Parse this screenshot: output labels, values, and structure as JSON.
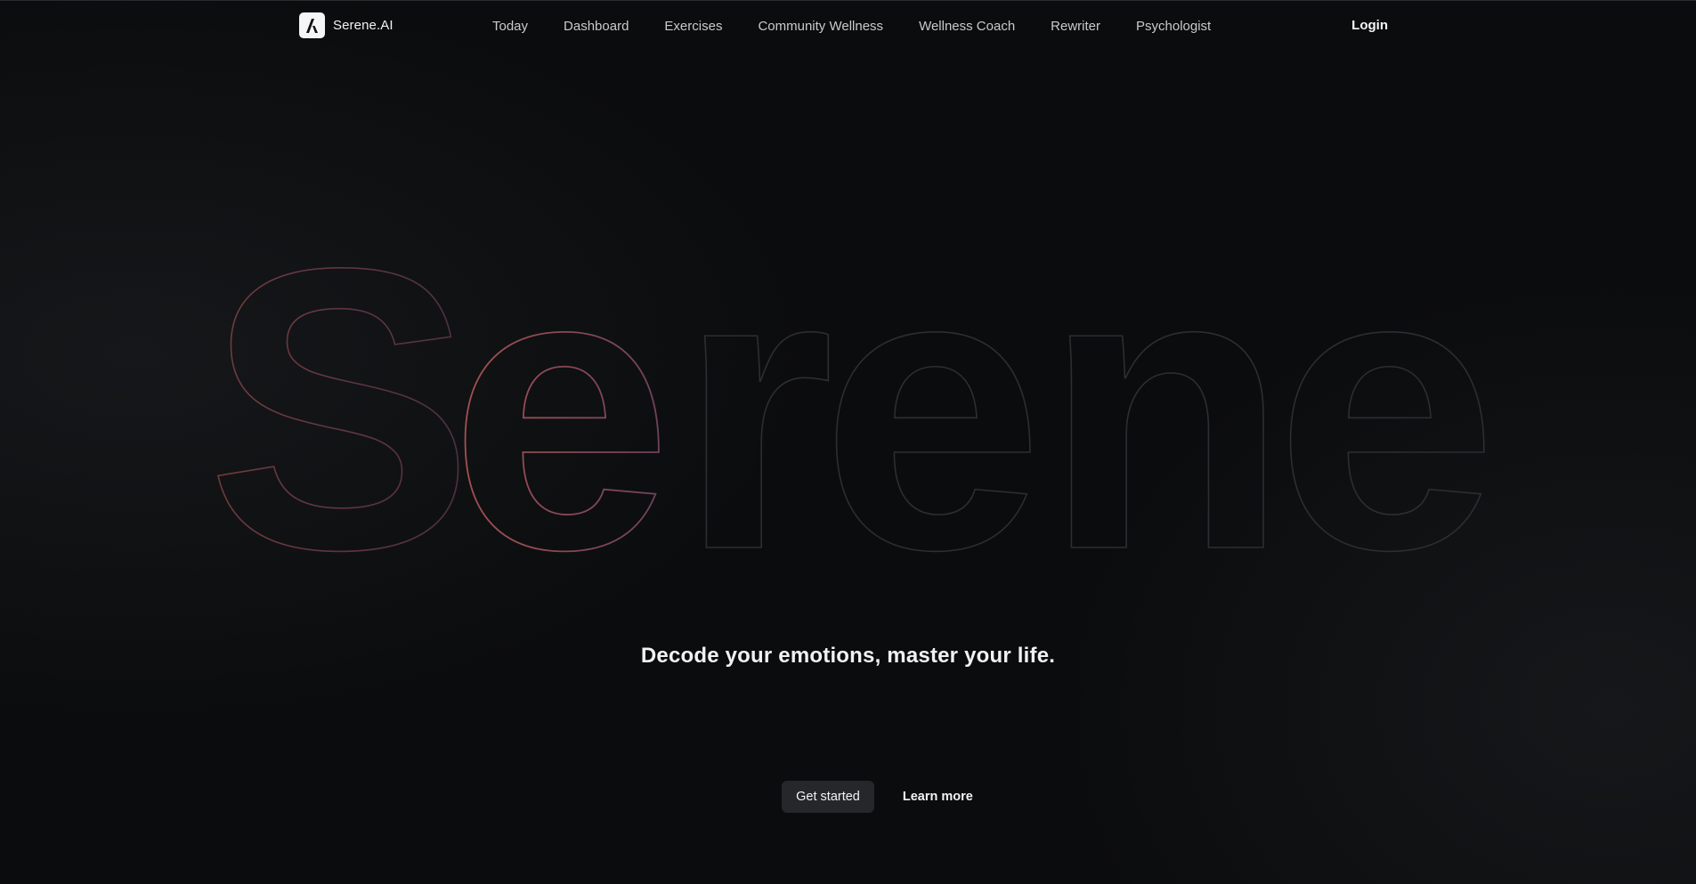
{
  "brand": {
    "name": "Serene.AI",
    "logo_icon": "serene-logo-icon"
  },
  "nav": {
    "items": [
      {
        "label": "Today"
      },
      {
        "label": "Dashboard"
      },
      {
        "label": "Exercises"
      },
      {
        "label": "Community Wellness"
      },
      {
        "label": "Wellness Coach"
      },
      {
        "label": "Rewriter"
      },
      {
        "label": "Psychologist"
      }
    ],
    "login_label": "Login"
  },
  "hero": {
    "word_letters": [
      "S",
      "e",
      "r",
      "e",
      "n",
      "e"
    ],
    "tagline": "Decode your emotions, master your life.",
    "primary_cta": "Get started",
    "secondary_cta": "Learn more"
  },
  "colors": {
    "background": "#0b0c0d",
    "outline_dim": "#2c2e31",
    "outline_accent_start": "#c25c5c",
    "outline_accent_end": "#8a4f68",
    "button_bg": "#26272b"
  }
}
